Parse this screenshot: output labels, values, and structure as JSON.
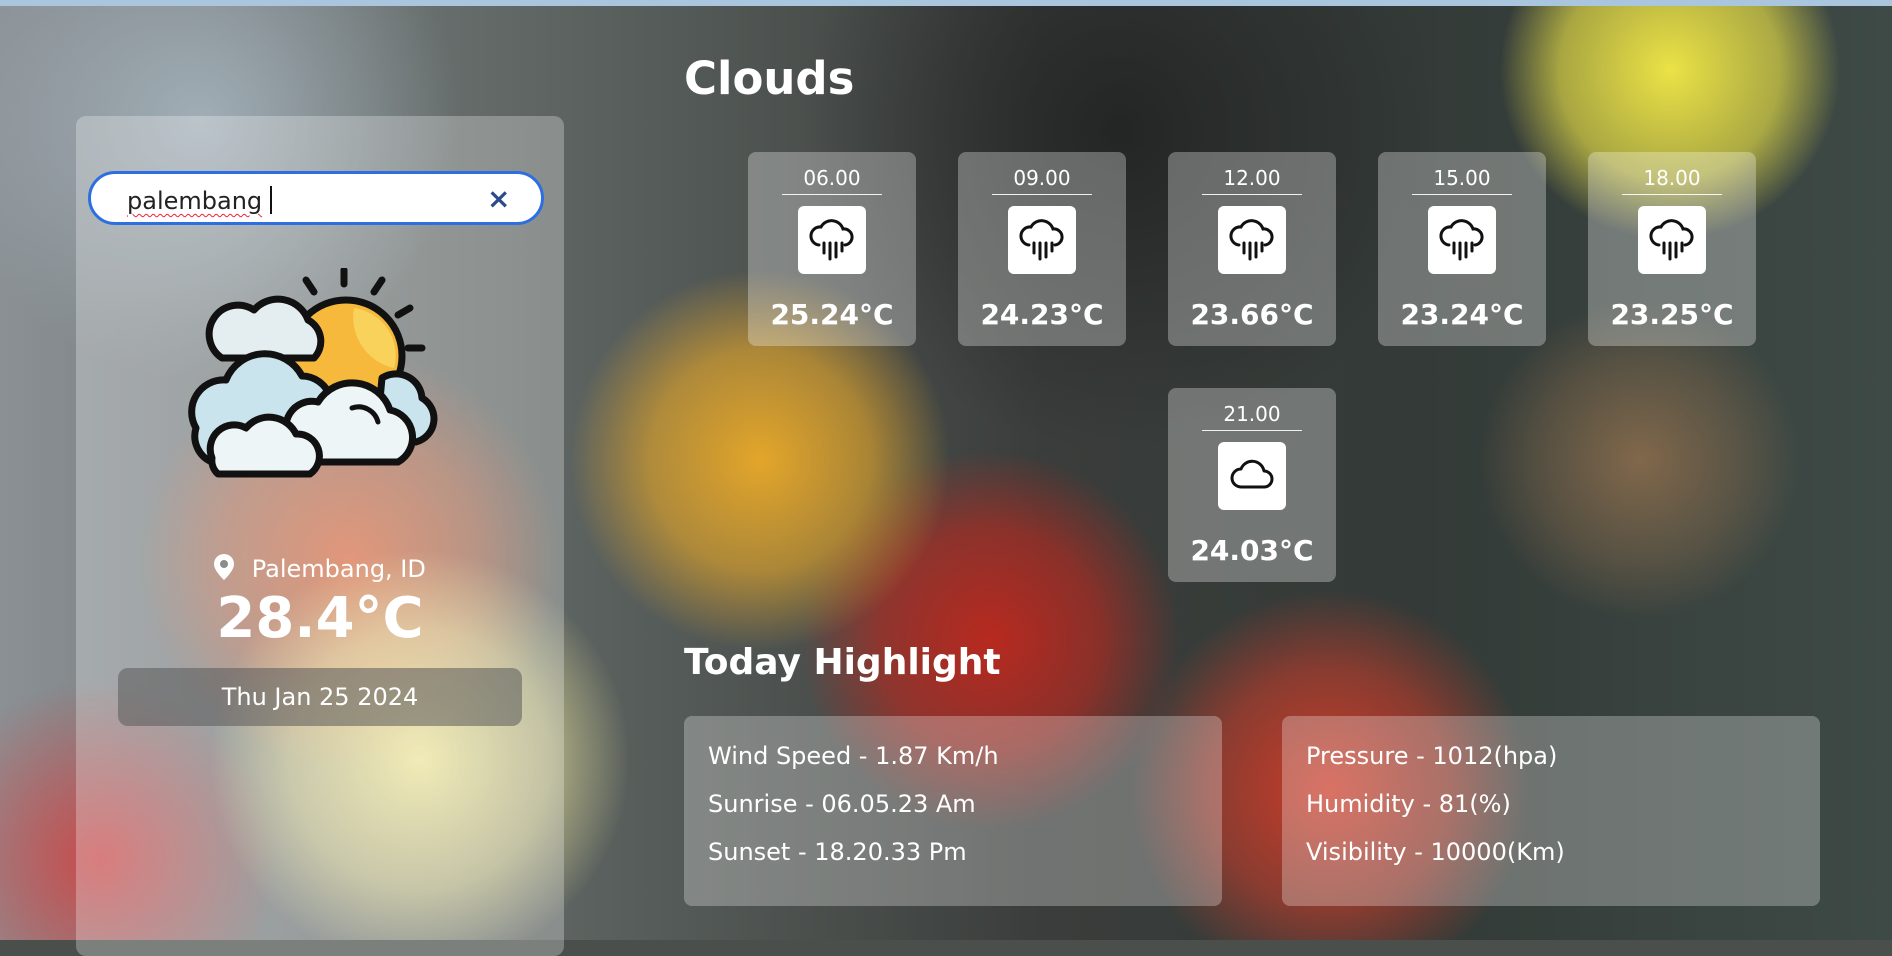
{
  "search": {
    "value": "palembang",
    "clear_label": "×"
  },
  "current": {
    "icon": "partly-cloudy-sun-icon",
    "location": "Palembang, ID",
    "temperature": "28.4°C",
    "date": "Thu Jan 25 2024"
  },
  "condition": "Clouds",
  "forecast": [
    {
      "time": "06.00",
      "icon": "rain-cloud-icon",
      "temp": "25.24°C"
    },
    {
      "time": "09.00",
      "icon": "rain-cloud-icon",
      "temp": "24.23°C"
    },
    {
      "time": "12.00",
      "icon": "rain-cloud-icon",
      "temp": "23.66°C"
    },
    {
      "time": "15.00",
      "icon": "rain-cloud-icon",
      "temp": "23.24°C"
    },
    {
      "time": "18.00",
      "icon": "rain-cloud-icon",
      "temp": "23.25°C"
    },
    {
      "time": "21.00",
      "icon": "cloud-icon",
      "temp": "24.03°C"
    }
  ],
  "highlight": {
    "title": "Today Highlight",
    "left": [
      "Wind Speed - 1.87 Km/h",
      "Sunrise - 06.05.23 Am",
      "Sunset - 18.20.33 Pm"
    ],
    "right": [
      "Pressure - 1012(hpa)",
      "Humidity - 81(%)",
      "Visibility - 10000(Km)"
    ]
  },
  "colors": {
    "accent": "#2d6fe0",
    "sun": "#f6b93b",
    "cloud": "#c9e4ec"
  }
}
